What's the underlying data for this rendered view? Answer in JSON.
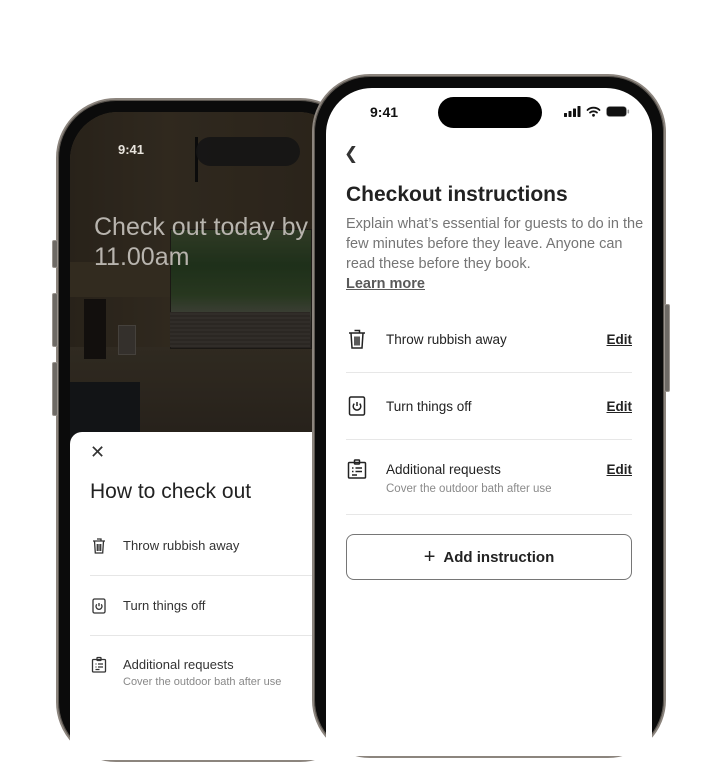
{
  "back_phone": {
    "status_time": "9:41",
    "headline": "Check out today by 11.00am",
    "sheet": {
      "close_icon": "close-icon",
      "title": "How to check out",
      "items": [
        {
          "icon": "trash-icon",
          "label": "Throw rubbish away",
          "sub": ""
        },
        {
          "icon": "power-icon",
          "label": "Turn things off",
          "sub": ""
        },
        {
          "icon": "clipboard-icon",
          "label": "Additional requests",
          "sub": "Cover the outdoor bath after use"
        }
      ]
    }
  },
  "front_phone": {
    "status_time": "9:41",
    "status_icons": [
      "signal-icon",
      "wifi-icon",
      "battery-icon"
    ],
    "back_icon": "chevron-left-icon",
    "title": "Checkout instructions",
    "description": "Explain what’s essential for guests to do in the few minutes before they leave. Anyone can read these before they book.",
    "learn_more": "Learn more",
    "items": [
      {
        "icon": "trash-icon",
        "label": "Throw rubbish away",
        "sub": "",
        "action": "Edit"
      },
      {
        "icon": "power-icon",
        "label": "Turn things off",
        "sub": "",
        "action": "Edit"
      },
      {
        "icon": "clipboard-icon",
        "label": "Additional requests",
        "sub": "Cover the outdoor bath after use",
        "action": "Edit"
      }
    ],
    "add_button": {
      "icon": "plus-icon",
      "label": "Add instruction"
    }
  }
}
